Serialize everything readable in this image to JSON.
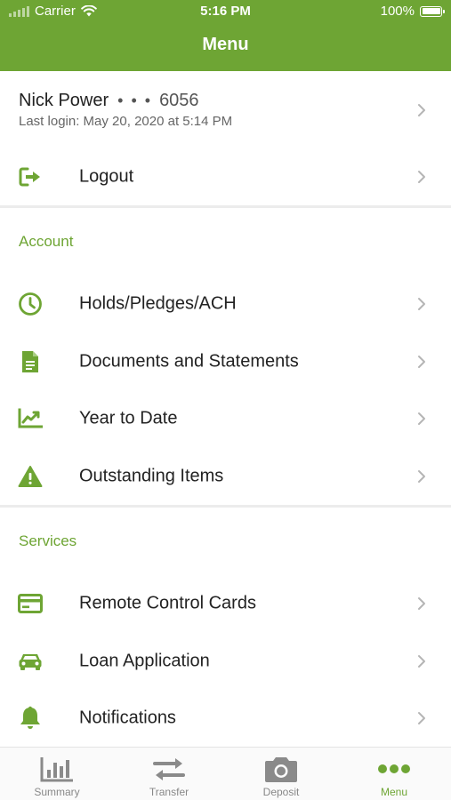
{
  "status_bar": {
    "carrier": "Carrier",
    "time": "5:16 PM",
    "battery": "100%"
  },
  "header": {
    "title": "Menu"
  },
  "profile": {
    "name": "Nick Power",
    "mask": "• • •",
    "account_suffix": "6056",
    "last_login": "Last login: May 20, 2020 at 5:14 PM"
  },
  "logout": {
    "label": "Logout",
    "icon": "logout-icon"
  },
  "account": {
    "title": "Account",
    "items": [
      {
        "label": "Holds/Pledges/ACH",
        "icon": "clock-icon"
      },
      {
        "label": "Documents and Statements",
        "icon": "document-icon"
      },
      {
        "label": "Year to Date",
        "icon": "chart-icon"
      },
      {
        "label": "Outstanding Items",
        "icon": "warning-icon"
      }
    ]
  },
  "services": {
    "title": "Services",
    "items": [
      {
        "label": "Remote Control Cards",
        "icon": "card-icon"
      },
      {
        "label": "Loan Application",
        "icon": "car-icon"
      },
      {
        "label": "Notifications",
        "icon": "bell-icon"
      }
    ]
  },
  "tabbar": {
    "tabs": [
      {
        "label": "Summary",
        "icon": "bar-chart-icon"
      },
      {
        "label": "Transfer",
        "icon": "transfer-icon"
      },
      {
        "label": "Deposit",
        "icon": "camera-icon"
      },
      {
        "label": "Menu",
        "icon": "more-icon",
        "active": true
      }
    ]
  },
  "colors": {
    "accent": "#6ea534",
    "text": "#222222",
    "inactive": "#888888"
  }
}
